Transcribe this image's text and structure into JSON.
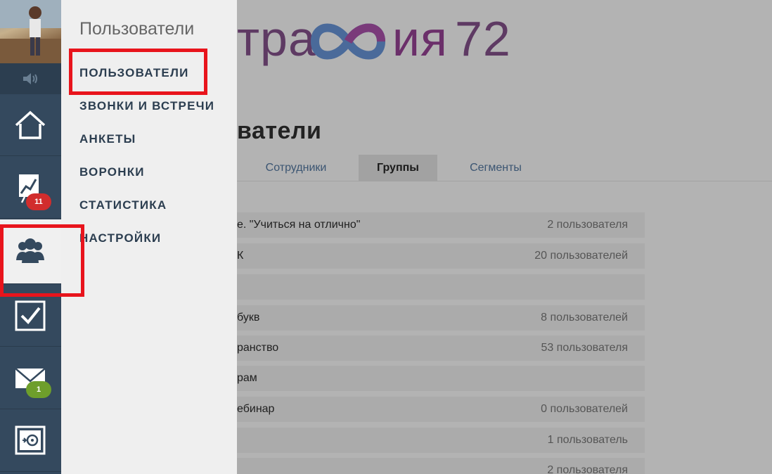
{
  "logo": {
    "text_prefix": "тра",
    "text_suffix": "ия",
    "number": "72"
  },
  "page": {
    "title": "ватели"
  },
  "tabs": [
    {
      "label": "Сотрудники",
      "active": false
    },
    {
      "label": "Группы",
      "active": true
    },
    {
      "label": "Сегменты",
      "active": false
    }
  ],
  "groups": [
    {
      "name": "е. \"Учиться на отлично\"",
      "count": "2 пользователя"
    },
    {
      "name": "К",
      "count": "20 пользователей"
    },
    {
      "name": "",
      "count": ""
    },
    {
      "name": "букв",
      "count": "8 пользователей"
    },
    {
      "name": "ранство",
      "count": "53 пользователя"
    },
    {
      "name": "рам",
      "count": ""
    },
    {
      "name": "ебинар",
      "count": "0 пользователей"
    },
    {
      "name": "",
      "count": "1 пользователь"
    },
    {
      "name": "",
      "count": "2 пользователя"
    }
  ],
  "rail": {
    "items": [
      {
        "icon": "home-icon"
      },
      {
        "icon": "chart-icon",
        "badge": "11",
        "badge_color": "#d12d2d"
      },
      {
        "icon": "users-icon",
        "active": true
      },
      {
        "icon": "checkbox-icon"
      },
      {
        "icon": "mail-icon",
        "badge": "1",
        "badge_color": "#6e9e2b"
      },
      {
        "icon": "safe-icon"
      }
    ]
  },
  "menu": {
    "title": "Пользователи",
    "items": [
      {
        "label": "ПОЛЬЗОВАТЕЛИ"
      },
      {
        "label": "ЗВОНКИ И ВСТРЕЧИ"
      },
      {
        "label": "АНКЕТЫ"
      },
      {
        "label": "ВОРОНКИ"
      },
      {
        "label": "СТАТИСТИКА"
      },
      {
        "label": "НАСТРОЙКИ"
      }
    ]
  },
  "colors": {
    "highlight": "#e8141c",
    "sidebar": "#34495e",
    "accent_logo": "#6b2f6a"
  }
}
